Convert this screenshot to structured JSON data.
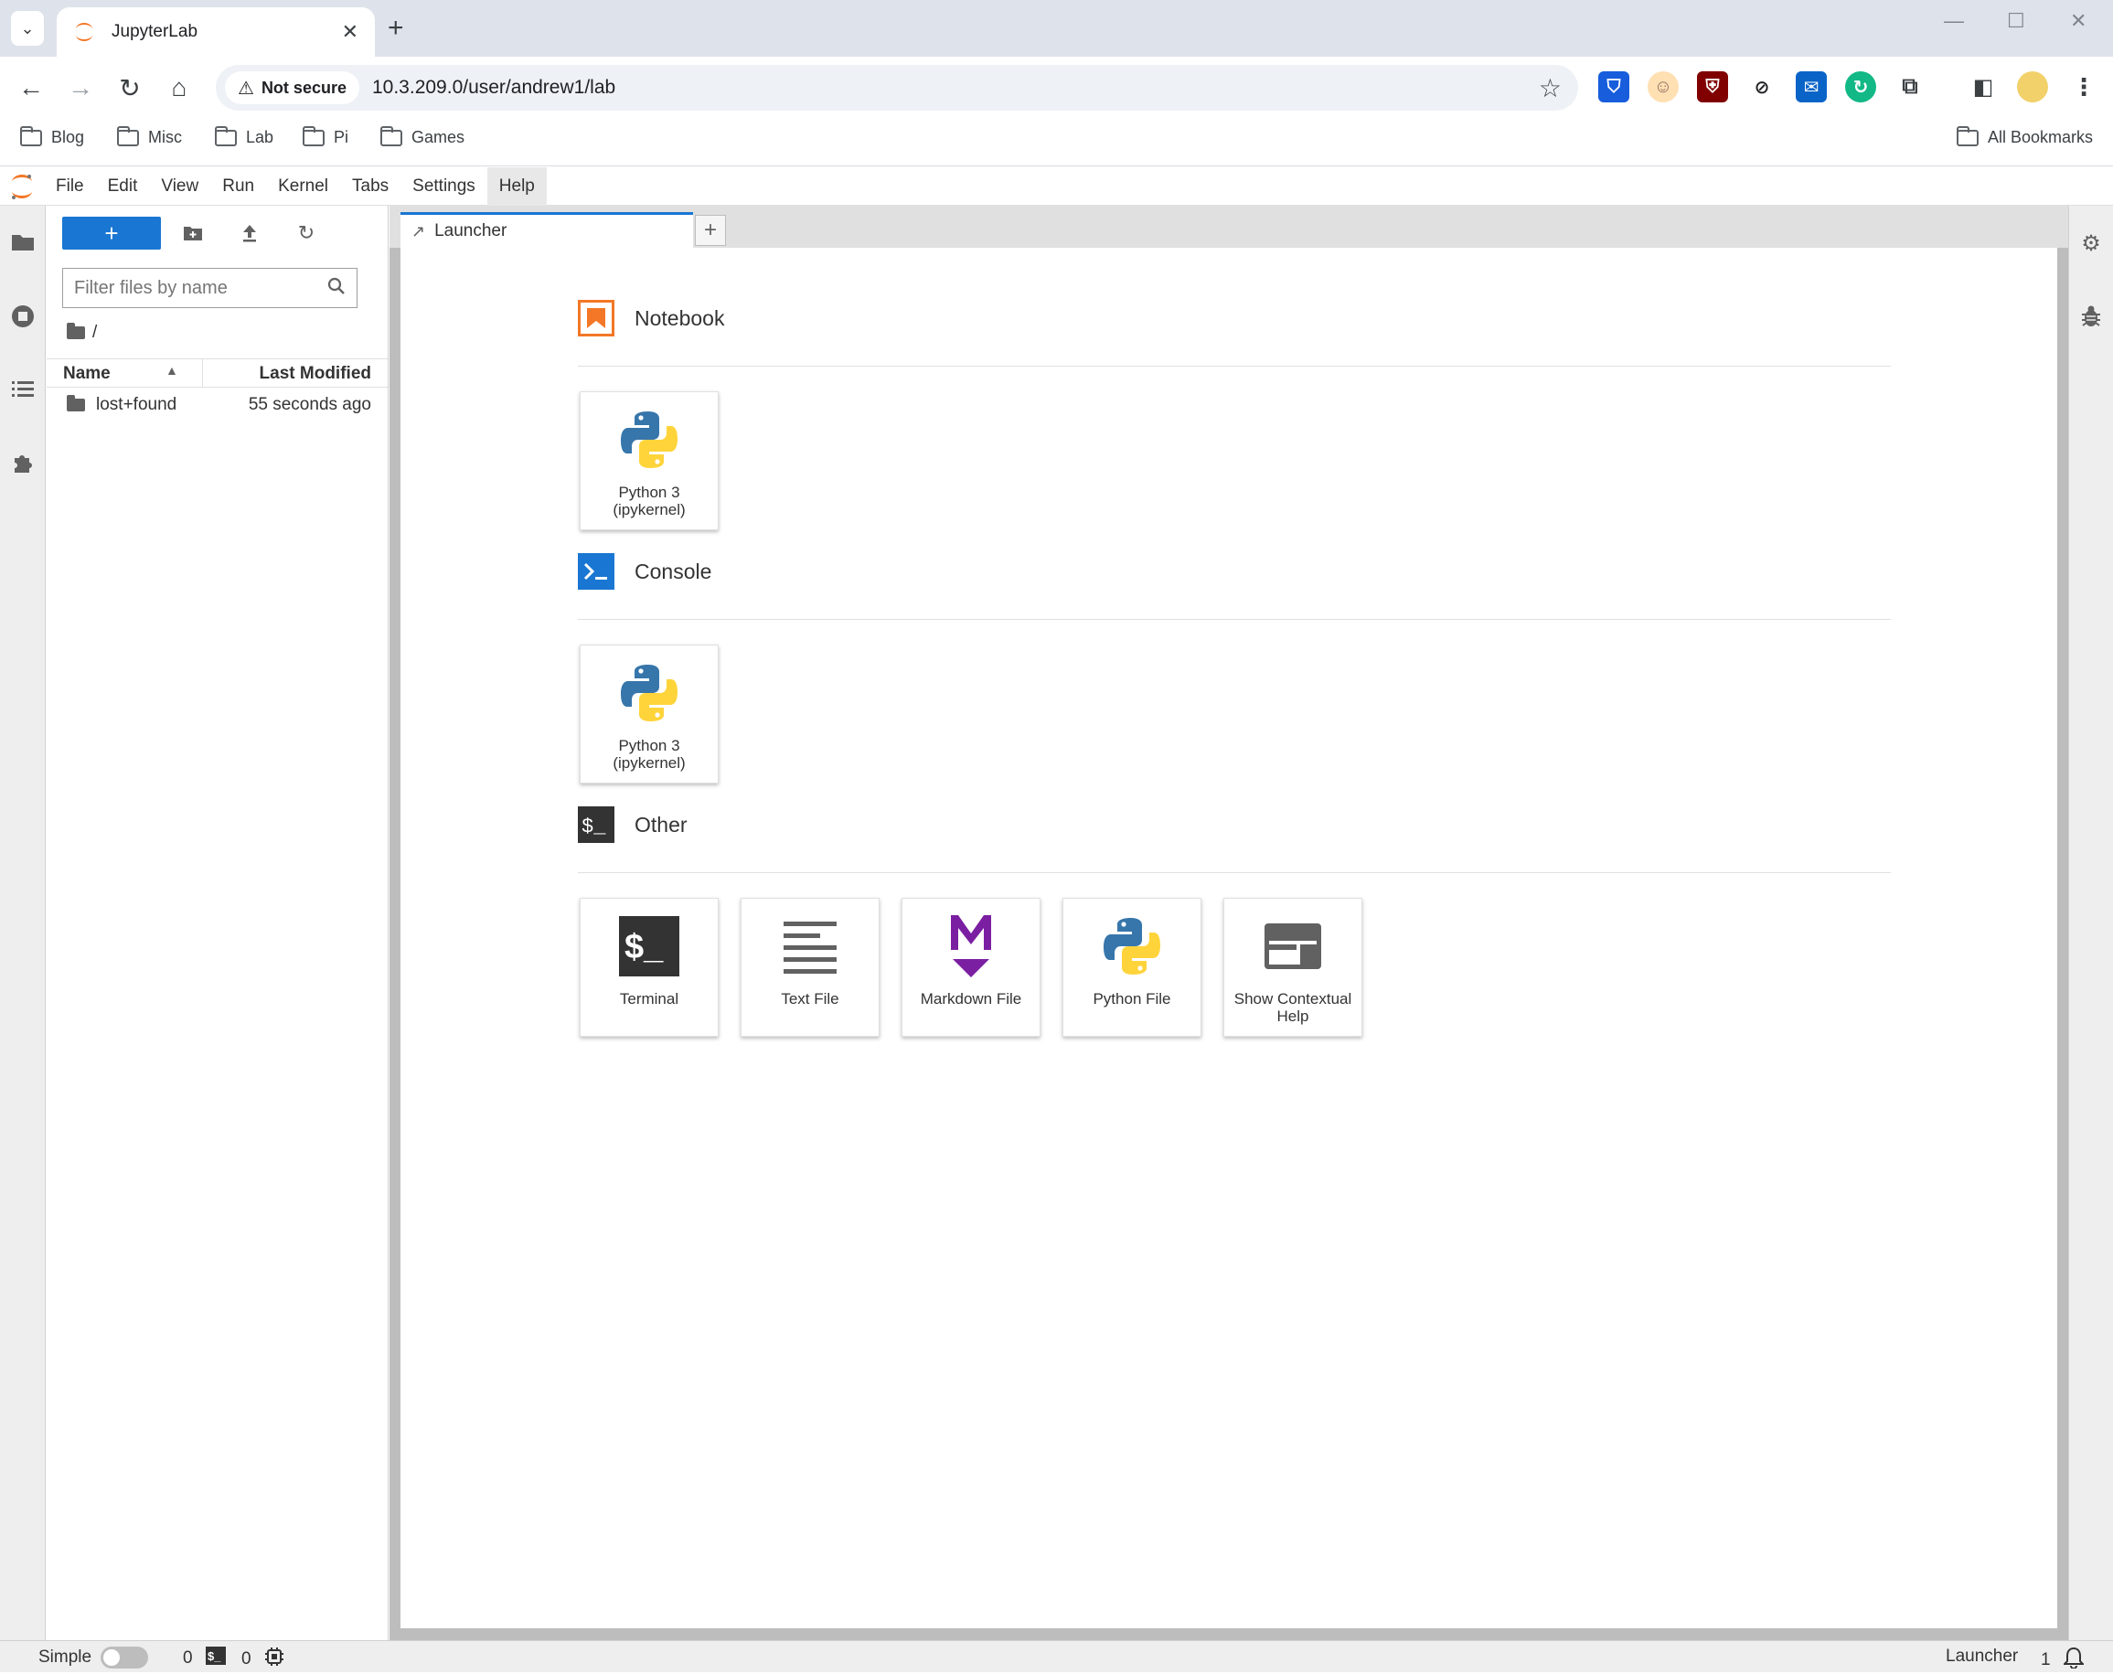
{
  "browser": {
    "tab_title": "JupyterLab",
    "security_label": "Not secure",
    "url": "10.3.209.0/user/andrew1/lab",
    "bookmarks": [
      "Blog",
      "Misc",
      "Lab",
      "Pi",
      "Games"
    ],
    "all_bookmarks": "All Bookmarks"
  },
  "menu": {
    "items": [
      "File",
      "Edit",
      "View",
      "Run",
      "Kernel",
      "Tabs",
      "Settings",
      "Help"
    ],
    "active": "Help"
  },
  "filebrowser": {
    "filter_placeholder": "Filter files by name",
    "breadcrumb": "/",
    "col_name": "Name",
    "col_modified": "Last Modified",
    "rows": [
      {
        "name": "lost+found",
        "modified": "55 seconds ago"
      }
    ]
  },
  "dock": {
    "tab_label": "Launcher"
  },
  "launcher": {
    "notebook": {
      "title": "Notebook",
      "cards": [
        {
          "line1": "Python 3",
          "line2": "(ipykernel)"
        }
      ]
    },
    "console": {
      "title": "Console",
      "cards": [
        {
          "line1": "Python 3",
          "line2": "(ipykernel)"
        }
      ]
    },
    "other": {
      "title": "Other",
      "cards": [
        {
          "line1": "Terminal",
          "line2": ""
        },
        {
          "line1": "Text File",
          "line2": ""
        },
        {
          "line1": "Markdown File",
          "line2": ""
        },
        {
          "line1": "Python File",
          "line2": ""
        },
        {
          "line1": "Show Contextual",
          "line2": "Help"
        }
      ]
    }
  },
  "statusbar": {
    "simple_label": "Simple",
    "terminals_count": "0",
    "kernels_count": "0",
    "mode_label": "Launcher",
    "notification_count": "1"
  },
  "colors": {
    "jupyter_orange": "#f37726",
    "accent_blue": "#1976d2",
    "markdown_purple": "#7b1fa2",
    "python_blue": "#3776ab",
    "python_yellow": "#ffd43b"
  }
}
